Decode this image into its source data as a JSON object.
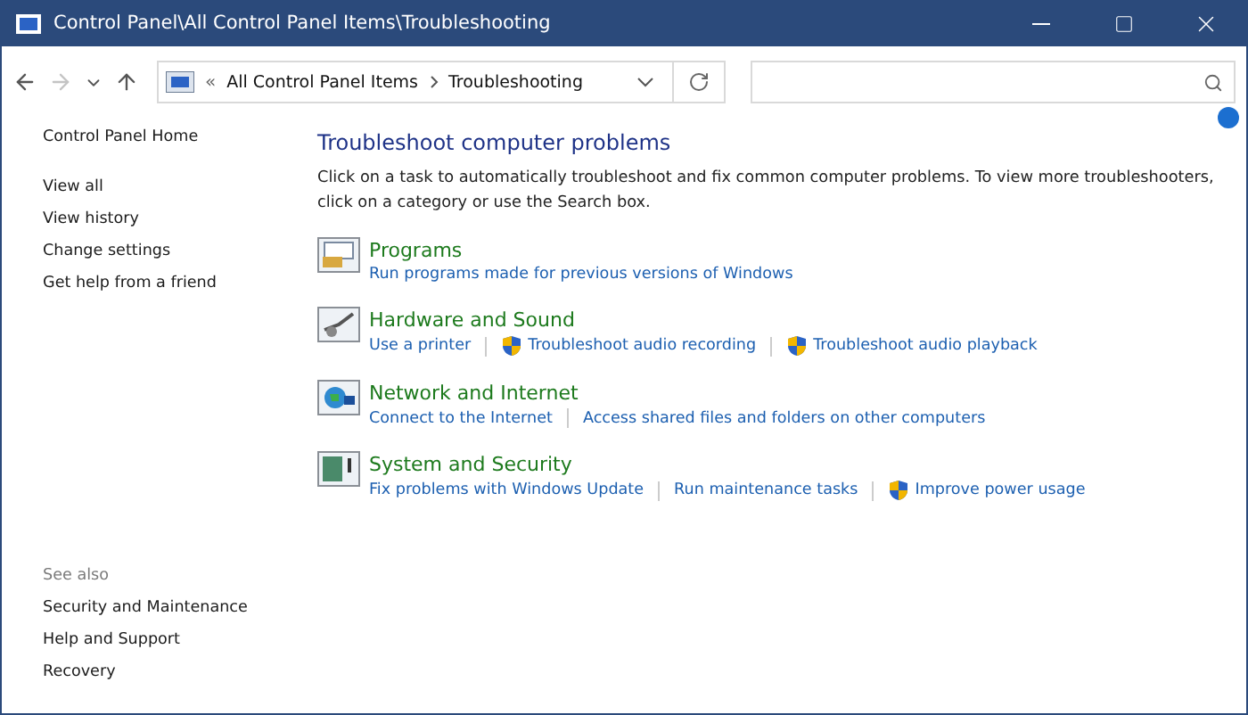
{
  "window": {
    "title": "Control Panel\\All Control Panel Items\\Troubleshooting"
  },
  "address": {
    "separator": "«",
    "crumbs": [
      "All Control Panel Items",
      "Troubleshooting"
    ]
  },
  "sidebar": {
    "home": "Control Panel Home",
    "items": [
      "View all",
      "View history",
      "Change settings",
      "Get help from a friend"
    ],
    "see_also_title": "See also",
    "see_also": [
      "Security and Maintenance",
      "Help and Support",
      "Recovery"
    ]
  },
  "main": {
    "heading": "Troubleshoot computer problems",
    "intro": "Click on a task to automatically troubleshoot and fix common computer problems. To view more troubleshooters, click on a category or use the Search box.",
    "categories": [
      {
        "title": "Programs",
        "tasks": [
          {
            "label": "Run programs made for previous versions of Windows",
            "shield": false
          }
        ]
      },
      {
        "title": "Hardware and Sound",
        "tasks": [
          {
            "label": "Use a printer",
            "shield": false
          },
          {
            "label": "Troubleshoot audio recording",
            "shield": true
          },
          {
            "label": "Troubleshoot audio playback",
            "shield": true
          }
        ]
      },
      {
        "title": "Network and Internet",
        "tasks": [
          {
            "label": "Connect to the Internet",
            "shield": false
          },
          {
            "label": "Access shared files and folders on other computers",
            "shield": false
          }
        ]
      },
      {
        "title": "System and Security",
        "tasks": [
          {
            "label": "Fix problems with Windows Update",
            "shield": false
          },
          {
            "label": "Run maintenance tasks",
            "shield": false
          },
          {
            "label": "Improve power usage",
            "shield": true
          }
        ]
      }
    ]
  }
}
